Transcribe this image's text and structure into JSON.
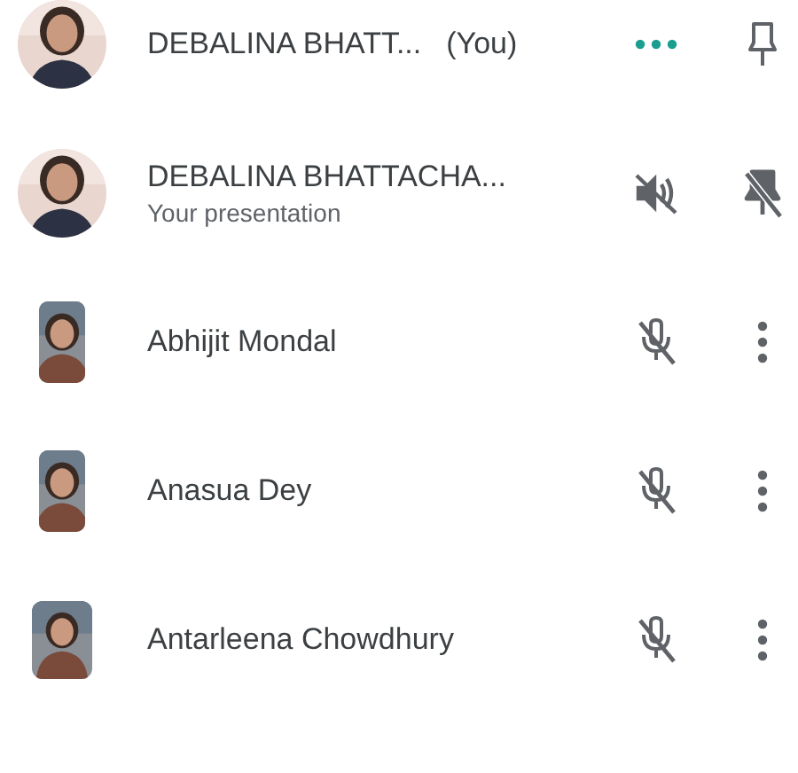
{
  "participants": [
    {
      "name": "DEBALINA BHATT...",
      "tag": "(You)",
      "avatar": {
        "kind": "circle"
      },
      "actions": [
        {
          "kind": "more-horizontal"
        },
        {
          "kind": "pin"
        }
      ]
    },
    {
      "name": "DEBALINA BHATTACHA...",
      "subtitle": "Your presentation",
      "avatar": {
        "kind": "circle"
      },
      "actions": [
        {
          "kind": "speaker-off"
        },
        {
          "kind": "pin-off"
        }
      ]
    },
    {
      "name": "Abhijit Mondal",
      "avatar": {
        "kind": "portrait"
      },
      "actions": [
        {
          "kind": "mic-off"
        },
        {
          "kind": "more-vertical"
        }
      ]
    },
    {
      "name": "Anasua Dey",
      "avatar": {
        "kind": "portrait"
      },
      "actions": [
        {
          "kind": "mic-off"
        },
        {
          "kind": "more-vertical"
        }
      ]
    },
    {
      "name": "Antarleena Chowdhury",
      "avatar": {
        "kind": "square"
      },
      "actions": [
        {
          "kind": "mic-off"
        },
        {
          "kind": "more-vertical"
        }
      ]
    }
  ]
}
